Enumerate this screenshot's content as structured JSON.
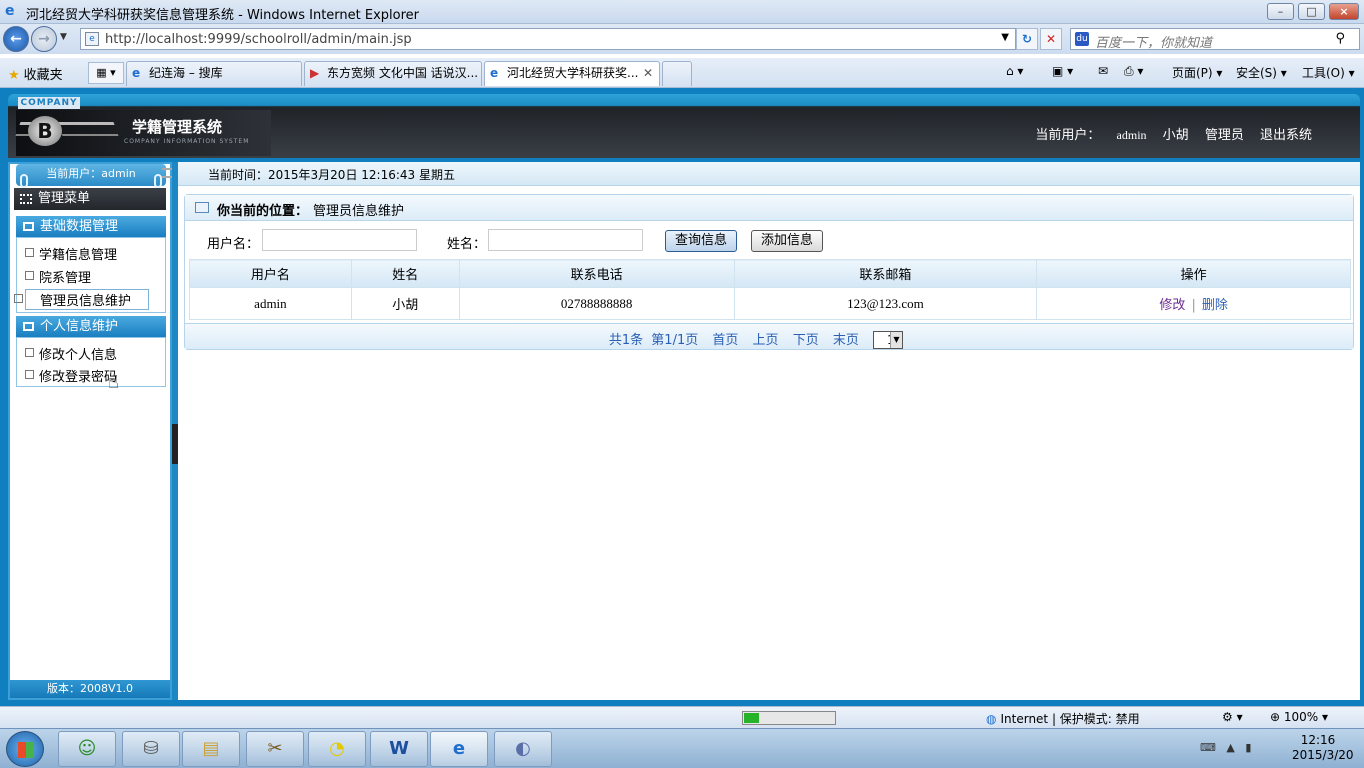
{
  "browser": {
    "window_title": "河北经贸大学科研获奖信息管理系统 - Windows Internet Explorer",
    "url": "http://localhost:9999/schoolroll/admin/main.jsp",
    "search_placeholder": "百度一下，你就知道",
    "favorites_label": "收藏夹",
    "tabs": [
      {
        "label": "纪连海 – 搜库",
        "active": false
      },
      {
        "label": "东方宽频 文化中国 话说汉...",
        "active": false
      },
      {
        "label": "河北经贸大学科研获奖...",
        "active": true
      }
    ],
    "commands": {
      "page": "页面(P)",
      "safety": "安全(S)",
      "tools": "工具(O)"
    },
    "status": {
      "zone": "Internet | 保护模式: 禁用",
      "zoom": "100%",
      "progress_fraction": 0.17
    }
  },
  "app": {
    "company_badge": "COMPANY",
    "system_title": "学籍管理系统",
    "system_subtitle": "COMPANY INFORMATION SYSTEM",
    "header_user": {
      "label": "当前用户：",
      "username": "admin",
      "name": "小胡",
      "role": "管理员",
      "logout": "退出系统"
    },
    "sidebar": {
      "current_user": "当前用户：admin",
      "menu_title": "管理菜单",
      "groups": [
        {
          "title": "基础数据管理",
          "items": [
            "学籍信息管理",
            "院系管理",
            "管理员信息维护"
          ]
        },
        {
          "title": "个人信息维护",
          "items": [
            "修改个人信息",
            "修改登录密码"
          ]
        }
      ],
      "selected_item": "管理员信息维护",
      "version": "版本：2008V1.0"
    },
    "time_bar": "当前时间：2015年3月20日  12:16:43  星期五",
    "breadcrumb": {
      "label": "你当前的位置：",
      "value": "管理员信息维护"
    },
    "search": {
      "username_label": "用户名：",
      "username_value": "",
      "name_label": "姓名：",
      "name_value": "",
      "query_button": "查询信息",
      "add_button": "添加信息"
    },
    "table": {
      "headers": [
        "用户名",
        "姓名",
        "联系电话",
        "联系邮箱",
        "操作"
      ],
      "rows": [
        {
          "username": "admin",
          "name": "小胡",
          "phone": "02788888888",
          "email": "123@123.com",
          "edit": "修改",
          "sep": "|",
          "delete": "删除"
        }
      ]
    },
    "pager": {
      "total": "共1条",
      "page_info": "第1/1页",
      "first": "首页",
      "prev": "上页",
      "next": "下页",
      "last": "末页",
      "page_select": "1"
    }
  },
  "taskbar": {
    "time": "12:16",
    "date": "2015/3/20"
  }
}
